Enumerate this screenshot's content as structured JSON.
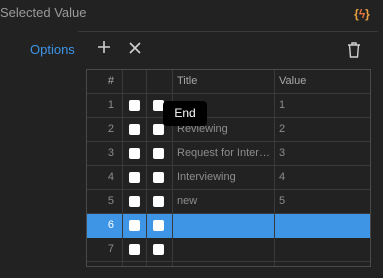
{
  "header": {
    "selected_value_label": "Selected Value",
    "code_icon": "code-braces-bolt-icon"
  },
  "toolbar": {
    "options_label": "Options",
    "add_icon": "plus-icon",
    "remove_icon": "x-icon",
    "delete_icon": "trash-icon"
  },
  "table": {
    "columns": [
      "#",
      "",
      "",
      "Title",
      "Value"
    ],
    "rows": [
      {
        "num": "1",
        "title": "",
        "value": "1",
        "selected": false
      },
      {
        "num": "2",
        "title": "Reviewing",
        "value": "2",
        "selected": false
      },
      {
        "num": "3",
        "title": "Request for Interview",
        "value": "3",
        "selected": false
      },
      {
        "num": "4",
        "title": "Interviewing",
        "value": "4",
        "selected": false
      },
      {
        "num": "5",
        "title": "new",
        "value": "5",
        "selected": false
      },
      {
        "num": "6",
        "title": "",
        "value": "",
        "selected": true
      },
      {
        "num": "7",
        "title": "",
        "value": "",
        "selected": false
      }
    ]
  },
  "tooltip": {
    "text": "End"
  },
  "colors": {
    "accent": "#3e95e6",
    "code_icon": "#e8a040"
  }
}
